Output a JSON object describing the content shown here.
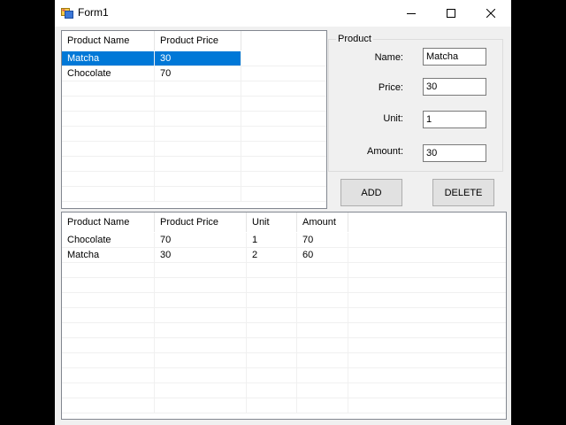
{
  "window": {
    "title": "Form1",
    "icon": "form-app-icon",
    "controls": [
      "minimize-icon",
      "maximize-icon",
      "close-icon"
    ]
  },
  "product_list": {
    "columns": [
      "Product Name",
      "Product Price"
    ],
    "rows": [
      {
        "name": "Matcha",
        "price": "30",
        "selected": true
      },
      {
        "name": "Chocolate",
        "price": "70",
        "selected": false
      }
    ],
    "selection_color": "#0078d7"
  },
  "product_group": {
    "title": "Product",
    "fields": {
      "name": {
        "label": "Name:",
        "value": "Matcha"
      },
      "price": {
        "label": "Price:",
        "value": "30"
      },
      "unit": {
        "label": "Unit:",
        "value": "1"
      },
      "amount": {
        "label": "Amount:",
        "value": "30"
      }
    }
  },
  "buttons": {
    "add": "ADD",
    "delete": "DELETE"
  },
  "order_list": {
    "columns": [
      "Product Name",
      "Product Price",
      "Unit",
      "Amount"
    ],
    "rows": [
      {
        "name": "Chocolate",
        "price": "70",
        "unit": "1",
        "amount": "70"
      },
      {
        "name": "Matcha",
        "price": "30",
        "unit": "2",
        "amount": "60"
      }
    ]
  }
}
